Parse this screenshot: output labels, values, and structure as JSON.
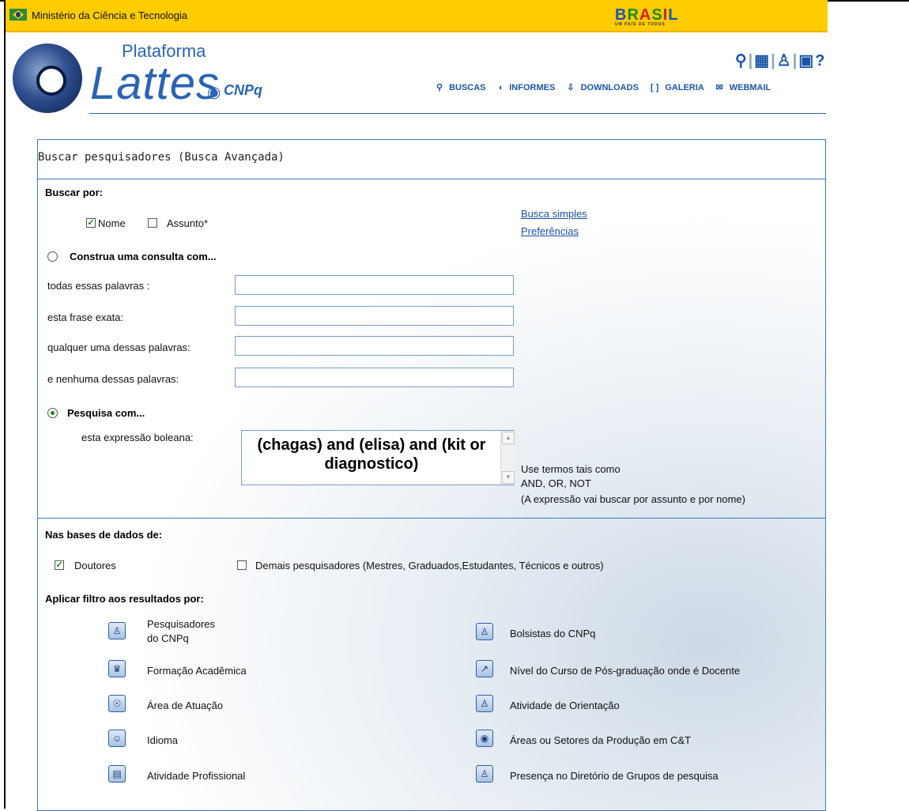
{
  "topbar": {
    "ministry": "Ministério da Ciência e Tecnologia",
    "brasil_logo": "BRASIL",
    "brasil_sub": "UM PAÍS DE TODOS"
  },
  "header": {
    "plataforma": "Plataforma",
    "lattes": "Lattes",
    "cnpq": "CNPq",
    "nav": [
      "BUSCAS",
      "INFORMES",
      "DOWNLOADS",
      "GALERIA",
      "WEBMAIL"
    ],
    "help": "?"
  },
  "panel": {
    "title": "Buscar pesquisadores (Busca Avançada)",
    "buscar_por": "Buscar por:",
    "nome": "Nome",
    "assunto": "Assunto*",
    "busca_simples": "Busca simples",
    "preferencias": "Preferências",
    "construa": "Construa uma consulta com...",
    "fields": [
      {
        "label": "todas essas palavras :",
        "value": ""
      },
      {
        "label": "esta frase exata:",
        "value": ""
      },
      {
        "label": "qualquer uma dessas palavras:",
        "value": ""
      },
      {
        "label": "e nenhuma dessas palavras:",
        "value": ""
      }
    ],
    "pesquisa": "Pesquisa com...",
    "boolean_label": "esta expressão boleana:",
    "boolean_value": "(chagas) and (elisa) and (kit or diagnostico)",
    "hint1": "Use termos tais como",
    "hint2": "AND, OR, NOT",
    "hint3": "(A expressão vai buscar por assunto e por nome)",
    "bases_title": "Nas bases de dados de:",
    "doutores": "Doutores",
    "demais": "Demais pesquisadores (Mestres, Graduados,Estudantes, Técnicos e outros)",
    "filtro_title": "Aplicar filtro aos resultados por:",
    "filters_left": [
      "Pesquisadores",
      "do CNPq",
      "Formação Acadêmica",
      "Área de Atuação",
      "Idioma",
      "Atividade Profissional"
    ],
    "filters_right": [
      "Bolsistas do CNPq",
      "Nível do Curso de Pós-graduação onde é Docente",
      "Atividade de Orientação",
      "Áreas ou Setores da Produção em C&T",
      "Presença no Diretório de Grupos de pesquisa"
    ]
  }
}
